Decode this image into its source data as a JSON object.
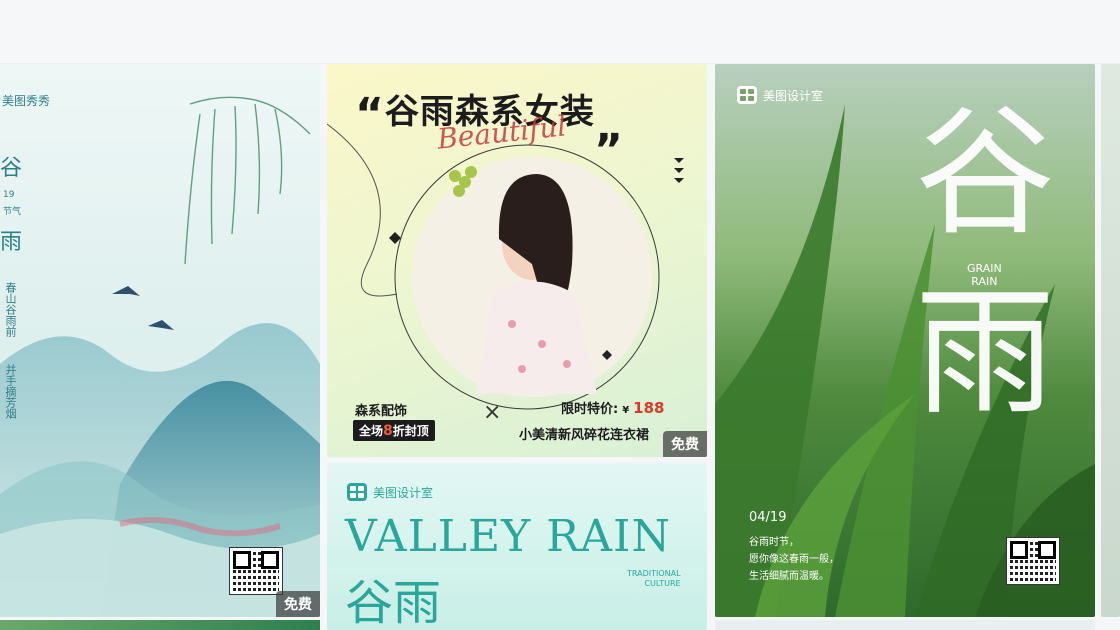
{
  "cards": {
    "c1": {
      "brand": "美图秀秀",
      "title_char_1": "谷",
      "date": "19",
      "subtitle": "节气",
      "title_char_2": "雨",
      "poem_col_1": "春山谷雨前",
      "poem_col_2": "并手摘芳烟",
      "badge": "免费"
    },
    "c2": {
      "headline": "谷雨森系女装",
      "script_text": "Beautiful",
      "left_label": "森系配饰",
      "discount_prefix": "全场",
      "discount_num": "8",
      "discount_suffix": "折封顶",
      "times": "×",
      "price_label": "限时特价:",
      "currency": "¥",
      "price": "188",
      "product": "小美清新风碎花连衣裙",
      "badge": "免费"
    },
    "c3": {
      "brand": "美图设计室",
      "title_en": "VALLEY RAIN",
      "title_cn": "谷雨",
      "tag_1": "TRADITIONAL",
      "tag_2": "CULTURE"
    },
    "c4": {
      "brand": "美图设计室",
      "char_1": "谷",
      "char_2": "雨",
      "en_1": "GRAIN",
      "en_2": "RAIN",
      "date": "04/19",
      "line_1": "谷雨时节，",
      "line_2": "愿你像这春雨一般，",
      "line_3": "生活细腻而温暖。"
    }
  },
  "colors": {
    "accent_teal": "#2aa79a",
    "price_red": "#d8392b",
    "ink": "#1c1c1c"
  }
}
